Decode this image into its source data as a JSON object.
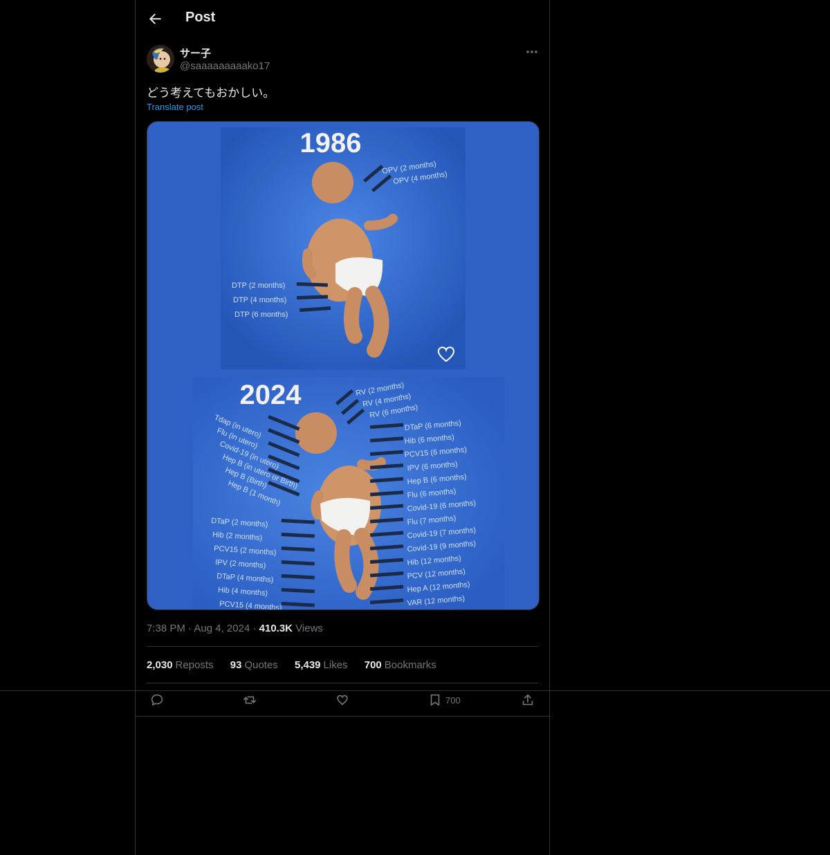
{
  "header": {
    "title": "Post"
  },
  "post": {
    "display_name": "サー子",
    "handle": "@saaaaaaaaako17",
    "text": "どう考えてもおかしい。",
    "translate_label": "Translate post",
    "time": "7:38 PM",
    "date": "Aug 4, 2024",
    "views_count": "410.3K",
    "views_label": "Views"
  },
  "image": {
    "top_year": "1986",
    "bottom_year": "2024",
    "top_labels": [
      "OPV (2 months)",
      "OPV (4 months)",
      "DTP (2 months)",
      "DTP (4 months)",
      "DTP (6 months)"
    ],
    "bottom_left_labels": [
      "Tdap (in utero)",
      "Flu (in utero)",
      "Covid-19 (in utero)",
      "Hep B (in utero or Birth)",
      "Hep B (Birth)",
      "Hep B (1 month)",
      "DTaP (2 months)",
      "Hib (2 months)",
      "PCV15 (2 months)",
      "IPV (2 months)",
      "DTaP (4 months)",
      "Hib (4 months)",
      "PCV15 (4 months)"
    ],
    "bottom_right_labels": [
      "RV (2 months)",
      "RV (4 months)",
      "RV (6 months)",
      "DTaP (6 months)",
      "Hib (6 months)",
      "PCV15 (6 months)",
      "IPV (6 months)",
      "Hep B (6 months)",
      "Flu (6 months)",
      "Covid-19 (6 months)",
      "Flu (7 months)",
      "Covid-19 (7 months)",
      "Covid-19 (9 months)",
      "Hib (12 months)",
      "PCV (12 months)",
      "Hep A (12 months)",
      "VAR (12 months)"
    ]
  },
  "engagement": {
    "reposts_count": "2,030",
    "reposts_label": "Reposts",
    "quotes_count": "93",
    "quotes_label": "Quotes",
    "likes_count": "5,439",
    "likes_label": "Likes",
    "bookmarks_count": "700",
    "bookmarks_label": "Bookmarks"
  },
  "actions": {
    "bookmark_count": "700"
  },
  "colors": {
    "accent": "#1d9bf0",
    "background": "#000000",
    "border": "#2f3336",
    "muted": "#71767b",
    "image_blue": "#2f60c4"
  },
  "icons": [
    "back-arrow-icon",
    "more-icon",
    "heart-icon",
    "reply-icon",
    "repost-icon",
    "like-icon",
    "bookmark-icon",
    "share-icon"
  ]
}
